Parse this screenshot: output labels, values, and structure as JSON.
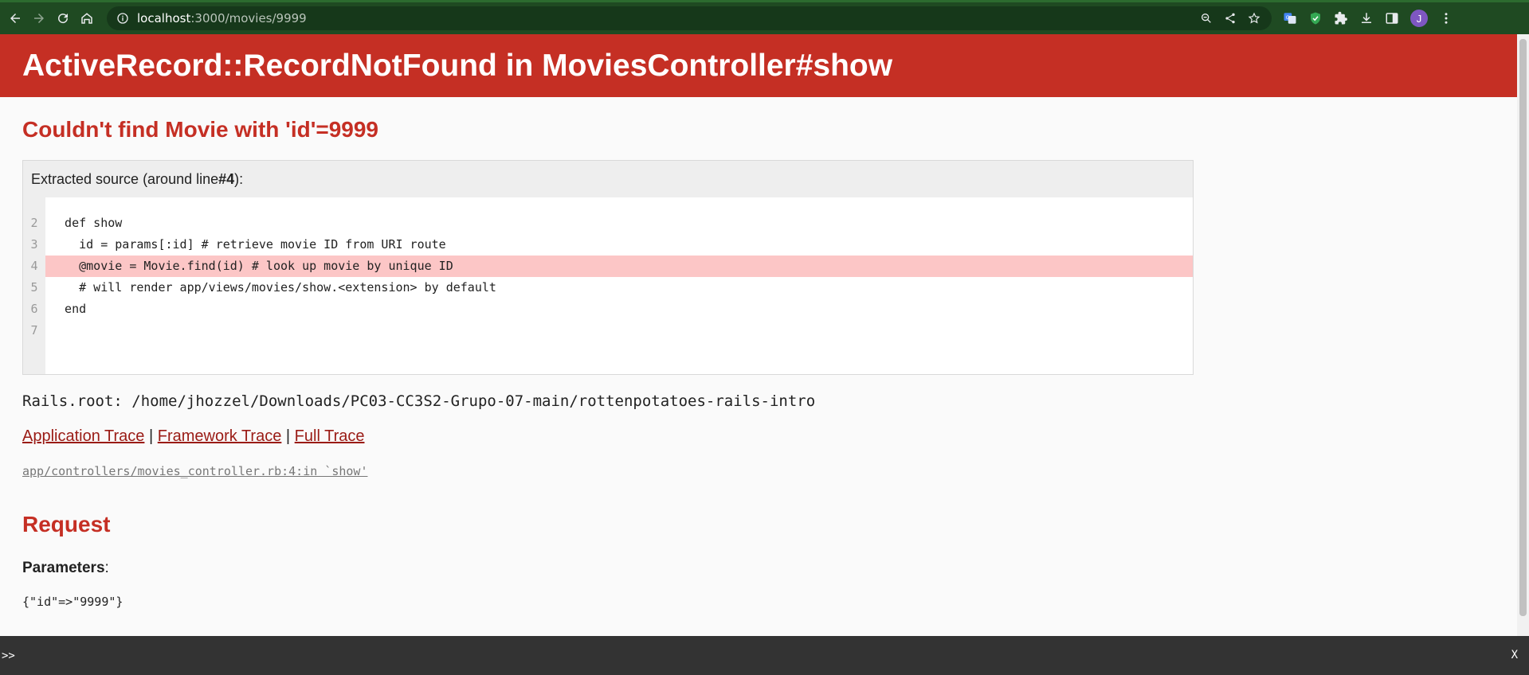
{
  "browser": {
    "url_host": "localhost",
    "url_path": ":3000/movies/9999",
    "profile_initial": "J",
    "icons": [
      "back-icon",
      "forward-icon",
      "reload-icon",
      "home-icon",
      "site-info-icon",
      "zoom-icon",
      "share-icon",
      "bookmark-star-icon",
      "translate-extension-icon",
      "shield-extension-icon",
      "puzzle-extensions-icon",
      "download-icon",
      "side-panel-icon",
      "menu-kebab-icon"
    ],
    "colors": {
      "toolbar": "#1f4a22"
    }
  },
  "error": {
    "title": "ActiveRecord::RecordNotFound in MoviesController#show",
    "message": "Couldn't find Movie with 'id'=9999"
  },
  "source": {
    "title_prefix": "Extracted source (around line ",
    "title_line": "#4",
    "title_suffix": "):",
    "line_numbers": [
      "2",
      "3",
      "4",
      "5",
      "6",
      "7"
    ],
    "lines": [
      "  def show",
      "    id = params[:id] # retrieve movie ID from URI route",
      "    @movie = Movie.find(id) # look up movie by unique ID",
      "    # will render app/views/movies/show.<extension> by default",
      "  end",
      ""
    ],
    "highlighted_line": "4"
  },
  "rails_root": "Rails.root: /home/jhozzel/Downloads/PC03-CC3S2-Grupo-07-main/rottenpotatoes-rails-intro",
  "traces": {
    "application": "Application Trace",
    "framework": "Framework Trace",
    "full": "Full Trace",
    "separator": "|",
    "first_frame": "app/controllers/movies_controller.rb:4:in `show'"
  },
  "request": {
    "heading": "Request",
    "params_label": "Parameters",
    "params_colon": ":",
    "params_value": "{\"id\"=>\"9999\"}"
  },
  "console": {
    "prompt": ">>",
    "close": "X"
  },
  "theme": {
    "rails_red": "#c52f24",
    "highlight": "#fcc6c6"
  }
}
